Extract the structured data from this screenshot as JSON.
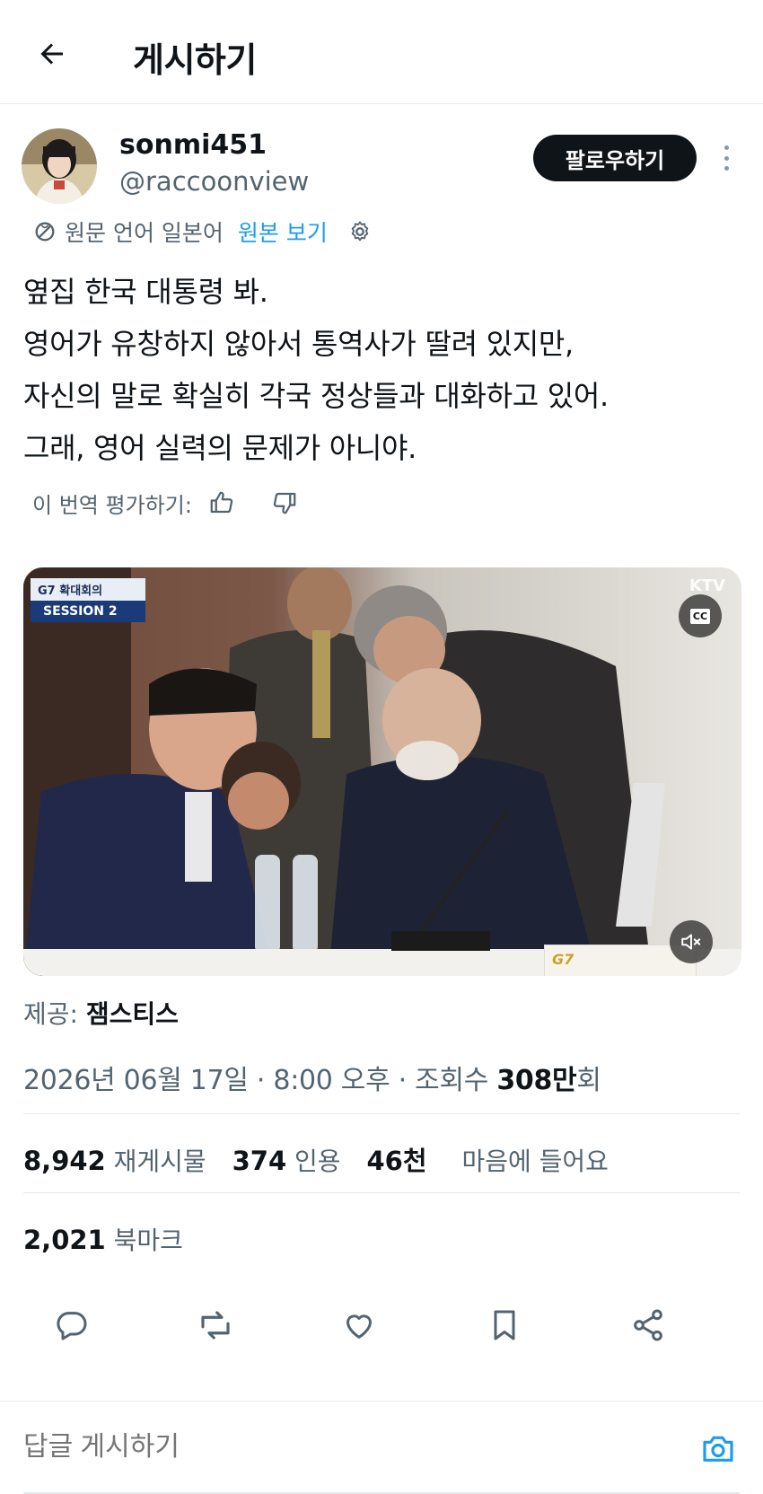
{
  "header": {
    "title": "게시하기"
  },
  "author": {
    "display_name": "sonmi451",
    "handle": "@raccoonview",
    "follow_label": "팔로우하기"
  },
  "translation": {
    "note": "원문 언어 일본어",
    "show_original": "원본 보기"
  },
  "tweet": {
    "lines": [
      "옆집 한국 대통령 봐.",
      "영어가 유창하지 않아서 통역사가 딸려 있지만,",
      "자신의 말로 확실히 각국 정상들과 대화하고 있어.",
      "그래, 영어 실력의 문제가 아니야."
    ]
  },
  "rating": {
    "label": "이 번역 평가하기:"
  },
  "video": {
    "badge_line1": "G7 확대회의",
    "badge_line2": "SESSION 2",
    "channel": "KTV",
    "cc_label": "CC",
    "nameplate": "G7"
  },
  "source": {
    "label": "제공:",
    "name": "잼스티스"
  },
  "meta": {
    "date": "2026년 06월 17일",
    "time": "8:00 오후",
    "views_label": "조회수",
    "views_value": "308만",
    "views_unit": "회"
  },
  "stats": {
    "reposts_value": "8,942",
    "reposts_label": "재게시물",
    "quotes_value": "374",
    "quotes_label": "인용",
    "likes_value": "46천",
    "likes_label": "마음에 들어요",
    "bookmarks_value": "2,021",
    "bookmarks_label": "북마크"
  },
  "reply": {
    "placeholder": "답글 게시하기"
  },
  "colors": {
    "accent": "#1d9bf0",
    "text": "#0f1419",
    "muted": "#536471",
    "follow_bg": "#0f1419"
  }
}
